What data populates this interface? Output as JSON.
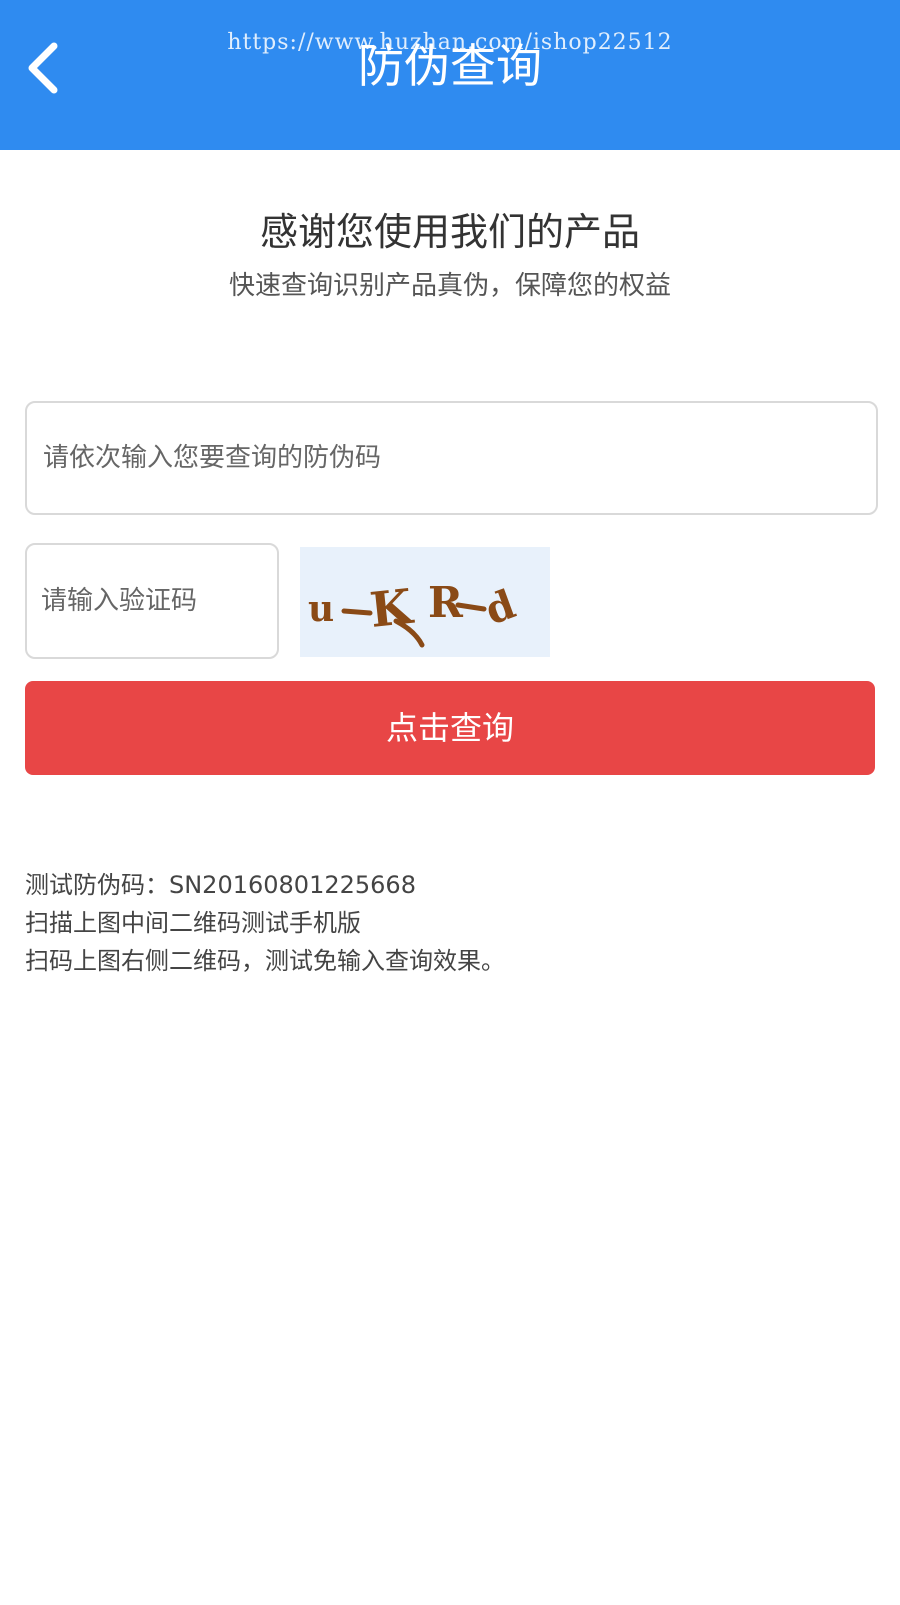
{
  "header": {
    "title": "防伪查询",
    "watermark": "https://www.huzhan.com/ishop22512",
    "back_icon": "chevron-left-icon"
  },
  "intro": {
    "title": "感谢您使用我们的产品",
    "subtitle": "快速查询识别产品真伪，保障您的权益"
  },
  "form": {
    "code_placeholder": "请依次输入您要查询的防伪码",
    "code_value": "",
    "captcha_placeholder": "请输入验证码",
    "captcha_value": "",
    "captcha_text": "u-KRd",
    "submit_label": "点击查询"
  },
  "notes": [
    "测试防伪码：SN20160801225668",
    "扫描上图中间二维码测试手机版",
    "扫码上图右侧二维码，测试免输入查询效果。"
  ],
  "colors": {
    "header_bg": "#2f8bf0",
    "submit_bg": "#e84646",
    "captcha_bg": "#e8f1fb",
    "captcha_ink": "#8a4a16"
  }
}
